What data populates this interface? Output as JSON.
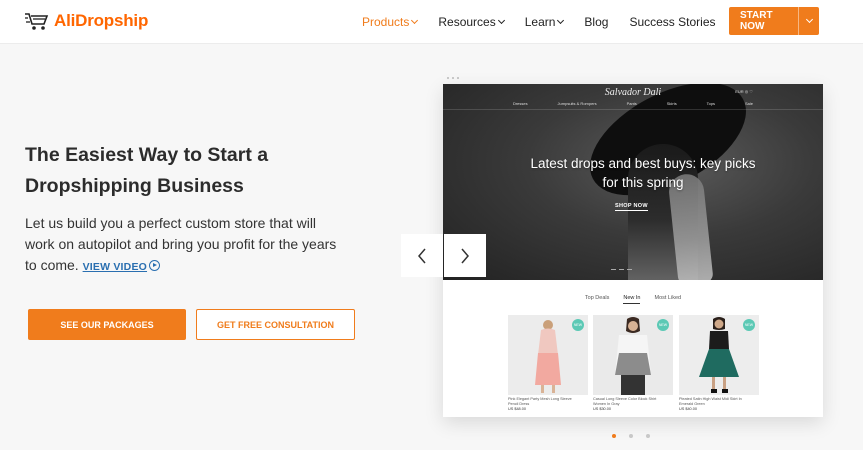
{
  "header": {
    "logo_text": "AliDropship",
    "nav": [
      {
        "label": "Products",
        "has_caret": true,
        "active": true
      },
      {
        "label": "Resources",
        "has_caret": true,
        "active": false
      },
      {
        "label": "Learn",
        "has_caret": true,
        "active": false
      },
      {
        "label": "Blog",
        "has_caret": false,
        "active": false
      },
      {
        "label": "Success Stories",
        "has_caret": false,
        "active": false
      }
    ],
    "cta_label": "START NOW"
  },
  "hero": {
    "title_line1": "The Easiest Way to Start a",
    "title_line2": "Dropshipping Business",
    "subtitle": "Let us build you a perfect custom store that will work on autopilot and bring you profit for the years to come.",
    "view_video": "VIEW VIDEO",
    "btn_packages": "SEE OUR PACKAGES",
    "btn_consult": "GET FREE CONSULTATION"
  },
  "mockup": {
    "brand": "Salvador Dali",
    "menu": [
      "Dresses",
      "Jumpsuits & Rompers",
      "Pants",
      "Skirts",
      "Tops",
      "Sale"
    ],
    "tools": "EUR  ◎  ♡",
    "headline": "Latest drops and best buys: key picks for this spring",
    "shop_now": "SHOP NOW",
    "tabs": [
      {
        "label": "Top Deals",
        "active": false
      },
      {
        "label": "New In",
        "active": true
      },
      {
        "label": "Most Liked",
        "active": false
      }
    ],
    "products": [
      {
        "name": "Pink Elegant Party Mesh Long Sleeve Pencil Dress",
        "price": "US $48.00",
        "badge": "NEW"
      },
      {
        "name": "Casual Long Sleeve Color Block Shirt Women In Gray",
        "price": "US $30.00",
        "badge": "NEW"
      },
      {
        "name": "Pleated Satin High Waist Midi Skirt In Emerald Green",
        "price": "US $40.00",
        "badge": "NEW"
      }
    ]
  },
  "carousel": {
    "active_slide": 1,
    "slide_count": 3
  },
  "colors": {
    "accent": "#f07c1c",
    "link": "#2a6fb0",
    "badge": "#5cc9b5"
  }
}
